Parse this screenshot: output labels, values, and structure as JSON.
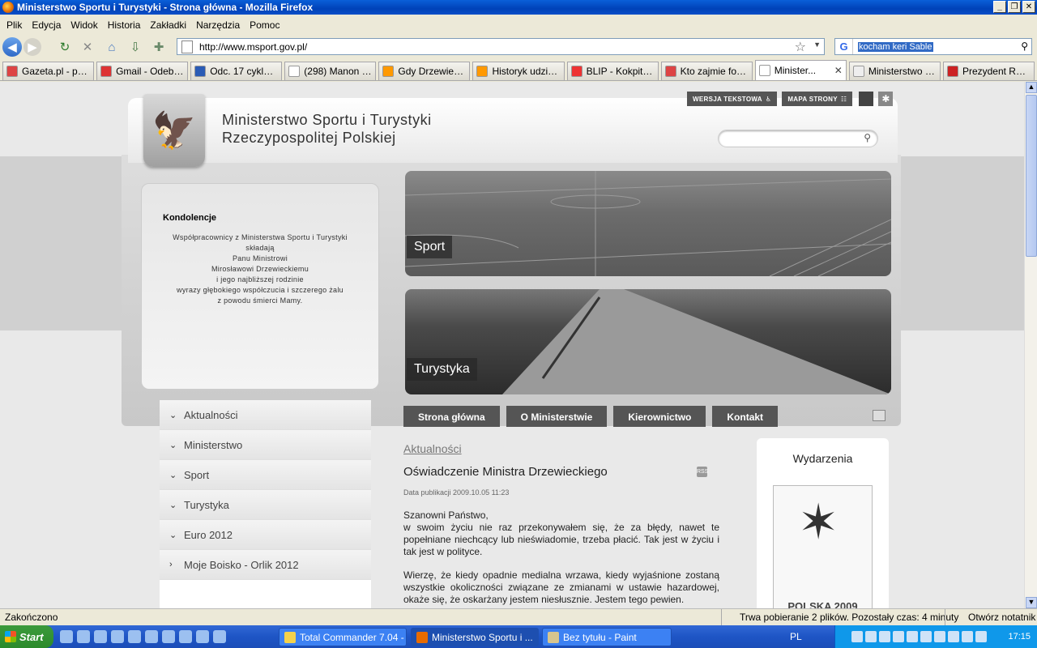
{
  "window": {
    "title": "Ministerstwo Sportu i Turystyki - Strona główna - Mozilla Firefox"
  },
  "menu": [
    "Plik",
    "Edycja",
    "Widok",
    "Historia",
    "Zakładki",
    "Narzędzia",
    "Pomoc"
  ],
  "nav": {
    "url": "http://www.msport.gov.pl/",
    "search_value": "kocham keri Sable",
    "search_engine": "G"
  },
  "tabs": [
    {
      "label": "Gazeta.pl - por...",
      "color": "#d44"
    },
    {
      "label": "Gmail - Odebra...",
      "color": "#d33"
    },
    {
      "label": "Odc. 17 cyklu '...",
      "color": "#2a5bb5"
    },
    {
      "label": "(298) Manon Fl...",
      "color": "#fff"
    },
    {
      "label": "Gdy Drzewiecki...",
      "color": "#f90"
    },
    {
      "label": "Historyk udzieli...",
      "color": "#f90"
    },
    {
      "label": "BLIP - Kokpit u...",
      "color": "#e33"
    },
    {
      "label": "Kto zajmie fote...",
      "color": "#d44"
    },
    {
      "label": "Minister...",
      "color": "#fff",
      "active": true
    },
    {
      "label": "Ministerstwo S...",
      "color": "#eee"
    },
    {
      "label": "Prezydent RP L...",
      "color": "#c22"
    }
  ],
  "site": {
    "name_line1": "Ministerstwo Sportu i Turystyki",
    "name_line2": "Rzeczypospolitej Polskiej",
    "text_version": "WERSJA TEKSTOWA",
    "sitemap": "MAPA STRONY",
    "condolences": {
      "title": "Kondolencje",
      "text": "Współpracownicy z Ministerstwa Sportu i Turystyki\nskładają\nPanu Ministrowi\nMirosławowi Drzewieckiemu\ni jego najbliższej rodzinie\nwyrazy głębokiego współczucia i szczerego żalu\nz powodu śmierci Mamy."
    },
    "banner_sport": "Sport",
    "banner_tourism": "Turystyka",
    "side_menu": [
      {
        "label": "Aktualności",
        "chev": "⌄"
      },
      {
        "label": "Ministerstwo",
        "chev": "⌄"
      },
      {
        "label": "Sport",
        "chev": "⌄"
      },
      {
        "label": "Turystyka",
        "chev": "⌄"
      },
      {
        "label": "Euro 2012",
        "chev": "⌄"
      },
      {
        "label": "Moje Boisko - Orlik 2012",
        "chev": "›"
      }
    ],
    "nav_tabs": [
      "Strona główna",
      "O Ministerstwie",
      "Kierownictwo",
      "Kontakt"
    ],
    "article": {
      "breadcrumb": "Aktualności",
      "title": "Oświadczenie Ministra Drzewieckiego",
      "date": "Data publikacji 2009.10.05 11:23",
      "p1": "Szanowni Państwo,\nw swoim życiu nie raz przekonywałem się, że za błędy, nawet te popełniane niechcący lub nieświadomie, trzeba płacić. Tak jest w życiu i tak jest w polityce.",
      "p2": "Wierzę, że kiedy opadnie medialna wrzawa, kiedy wyjaśnione zostaną wszystkie okoliczności związane ze zmianami w ustawie hazardowej, okaże się, że oskarżany jestem niesłusznie. Jestem tego pewien."
    },
    "events": {
      "title": "Wydarzenia",
      "badge": "POLSKA 2009"
    }
  },
  "status": {
    "left": "Zakończono",
    "download": "Trwa pobieranie 2 plików. Pozostały czas: 4 minuty",
    "notepad": "Otwórz notatnik"
  },
  "taskbar": {
    "start": "Start",
    "items": [
      {
        "label": "Total Commander 7.04 - ...",
        "color": "#f4d24c"
      },
      {
        "label": "Ministerstwo Sportu i ...",
        "color": "#e76b00",
        "active": true
      },
      {
        "label": "Bez tytułu - Paint",
        "color": "#d7c58f"
      }
    ],
    "lang": "PL",
    "clock": "17:15"
  }
}
